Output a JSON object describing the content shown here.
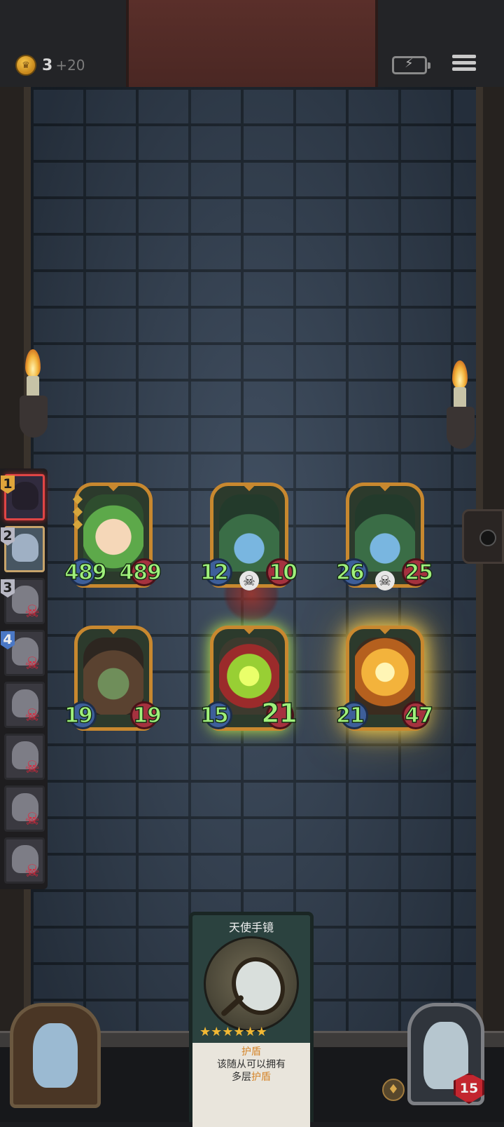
{
  "top_bar": {
    "gold_amount": "3",
    "gold_income": "+20",
    "battery_icon": "battery-charging-icon",
    "menu_icon": "menu-icon"
  },
  "roster": [
    {
      "number": "1",
      "state": "active"
    },
    {
      "number": "2",
      "state": "alive"
    },
    {
      "number": "3",
      "state": "dead"
    },
    {
      "number": "4",
      "state": "dead"
    },
    {
      "number": "",
      "state": "dead"
    },
    {
      "number": "",
      "state": "dead"
    },
    {
      "number": "",
      "state": "dead"
    },
    {
      "number": "",
      "state": "dead"
    }
  ],
  "board": {
    "units": [
      {
        "name": "mandrake",
        "attack": "489",
        "health": "489"
      },
      {
        "name": "vine-crystal-a",
        "attack": "12",
        "health": "10"
      },
      {
        "name": "vine-crystal-b",
        "attack": "26",
        "health": "25"
      },
      {
        "name": "goblin-hat",
        "attack": "19",
        "health": "19"
      },
      {
        "name": "clown-glow",
        "attack": "15",
        "health": "21"
      },
      {
        "name": "pumpkin-skull",
        "attack": "21",
        "health": "47"
      }
    ]
  },
  "item_card": {
    "title": "天使手镜",
    "stars": "★★★★★★",
    "keyword": "护盾",
    "desc_line1": "该随从可以拥有",
    "desc_line2_prefix": "多层",
    "desc_line2_keyword": "护盾"
  },
  "hero": {
    "health": "15"
  },
  "colors": {
    "brick": "#38475a",
    "frame_gold": "#c8882f",
    "stat_green": "#9ff07b",
    "skull_red": "#e2253a"
  }
}
